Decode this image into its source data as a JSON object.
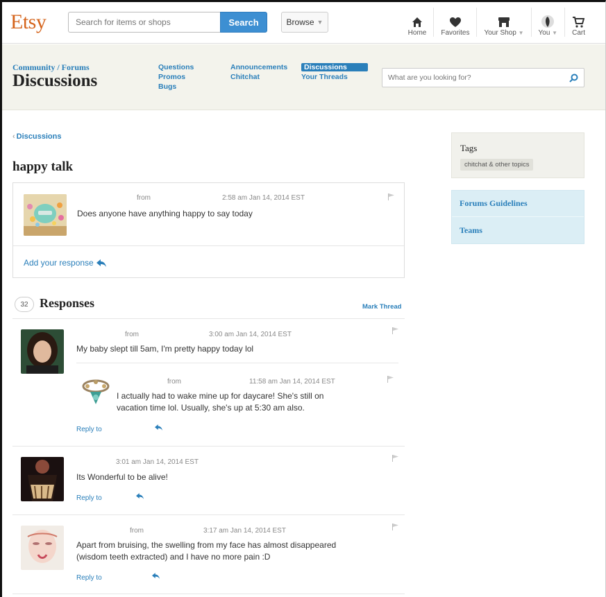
{
  "header": {
    "logo": "Etsy",
    "search_placeholder": "Search for items or shops",
    "search_label": "Search",
    "browse_label": "Browse",
    "nav": [
      {
        "label": "Home",
        "icon": "home-icon"
      },
      {
        "label": "Favorites",
        "icon": "heart-icon"
      },
      {
        "label": "Your Shop",
        "icon": "shop-icon"
      },
      {
        "label": "You",
        "icon": "avatar-icon"
      },
      {
        "label": "Cart",
        "icon": "cart-icon"
      }
    ]
  },
  "forum": {
    "breadcrumb": "Community / Forums",
    "title": "Discussions",
    "links": {
      "questions": "Questions",
      "announcements": "Announcements",
      "discussions": "Discussions",
      "promos": "Promos",
      "chitchat": "Chitchat",
      "your_threads": "Your Threads",
      "bugs": "Bugs"
    },
    "search_placeholder": "What are you looking for?"
  },
  "thread": {
    "back_label": "Discussions",
    "title": "happy talk",
    "op": {
      "from": "from",
      "time": "2:58 am Jan 14, 2014 EST",
      "text": "Does anyone have anything happy to say today"
    },
    "add_response": "Add your response"
  },
  "responses": {
    "count": "32",
    "title": "Responses",
    "mark_thread": "Mark Thread",
    "reply_label": "Reply to",
    "items": [
      {
        "from": "from",
        "time": "3:00 am Jan 14, 2014 EST",
        "text": "My baby slept till 5am, I'm pretty happy today lol",
        "reply": {
          "from": "from",
          "time": "11:58 am Jan 14, 2014 EST",
          "text1": "I actually had to wake mine up for daycare! She's still on",
          "text2": "vacation time lol. Usually, she's up at 5:30 am also."
        }
      },
      {
        "time": "3:01 am Jan 14, 2014 EST",
        "text": "Its Wonderful to be alive!"
      },
      {
        "from": "from",
        "time": "3:17 am Jan 14, 2014 EST",
        "text1": "Apart from bruising, the swelling from my face has almost disappeared",
        "text2": "(wisdom teeth extracted) and I have no more pain :D"
      }
    ]
  },
  "sidebar": {
    "tags_title": "Tags",
    "tag": "chitchat & other topics",
    "links": [
      "Forums Guidelines",
      "Teams"
    ]
  },
  "colors": {
    "brand": "#d5641c",
    "link": "#2a7fba",
    "search_button": "#3d8fd2"
  }
}
